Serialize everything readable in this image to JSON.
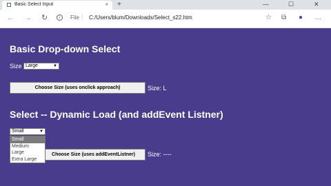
{
  "browser": {
    "tab_title": "Basic Select Input",
    "tab_close": "×",
    "new_tab": "+",
    "address": {
      "scheme": "File",
      "separator": "|",
      "url": "C:/Users/blum/Downloads/Select_s22.htm"
    },
    "window_controls": {
      "minimize": "—",
      "maximize": "☐",
      "close": "✕"
    },
    "nav": {
      "back": "←",
      "forward": "→",
      "reload": "↻"
    },
    "toolbar_icons": {
      "favorite": "☆",
      "collections": "⧉",
      "profile": "●",
      "menu": "…"
    }
  },
  "section1": {
    "heading": "Basic Drop-down Select",
    "size_label": "Size",
    "size_select_value": "Large",
    "button_label": "Choose Size (uses onclick approach)",
    "result": "Size: L"
  },
  "section2": {
    "heading": "Select -- Dynamic Load (and addEvent Listner)",
    "select_value": "Small",
    "options": [
      "Small",
      "Medium",
      "Large",
      "Extra Large"
    ],
    "button_label": "Choose Size (uses addEventListner)",
    "result": "Size: ----"
  },
  "colors": {
    "page_background": "#4a3c8c",
    "selected_option": "#7b7b7b"
  }
}
